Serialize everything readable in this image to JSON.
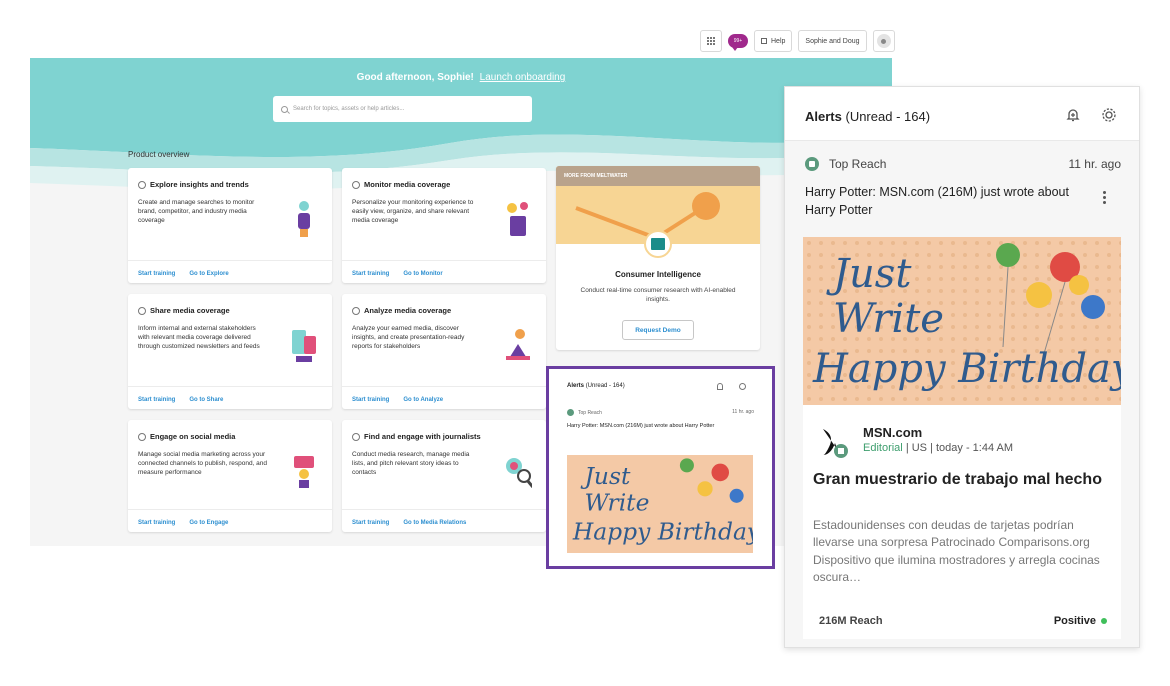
{
  "colors": {
    "teal": "#7fd3d1",
    "accent": "#a0298c",
    "highlight": "#6a3ea1",
    "link": "#2d8fd0",
    "positive": "#3fbf5b"
  },
  "topbar": {
    "apps_icon": "grid-icon",
    "chat_badge": "99+",
    "help_label": "Help",
    "user_label": "Sophie and Doug"
  },
  "hero": {
    "greeting": "Good afternoon, Sophie!",
    "onboarding_link": "Launch onboarding",
    "search_placeholder": "Search for topics, assets or help articles..."
  },
  "overview": {
    "label": "Product overview"
  },
  "cards": [
    {
      "title": "Explore insights and trends",
      "desc": "Create and manage searches to monitor brand, competitor, and industry media coverage",
      "link1": "Start training",
      "link2": "Go to Explore"
    },
    {
      "title": "Monitor media coverage",
      "desc": "Personalize your monitoring experience to easily view, organize, and share relevant media coverage",
      "link1": "Start training",
      "link2": "Go to Monitor"
    },
    {
      "title": "Share media coverage",
      "desc": "Inform internal and external stakeholders with relevant media coverage delivered through customized newsletters and feeds",
      "link1": "Start training",
      "link2": "Go to Share"
    },
    {
      "title": "Analyze media coverage",
      "desc": "Analyze your earned media, discover insights, and create presentation-ready reports for stakeholders",
      "link1": "Start training",
      "link2": "Go to Analyze"
    },
    {
      "title": "Engage on social media",
      "desc": "Manage social media marketing across your connected channels to publish, respond, and measure performance",
      "link1": "Start training",
      "link2": "Go to Engage"
    },
    {
      "title": "Find and engage with journalists",
      "desc": "Conduct media research, manage media lists, and pitch relevant story ideas to contacts",
      "link1": "Start training",
      "link2": "Go to Media Relations"
    }
  ],
  "promo": {
    "header": "MORE FROM MELTWATER",
    "title": "Consumer Intelligence",
    "desc": "Conduct real-time consumer research with AI-enabled insights.",
    "button": "Request Demo"
  },
  "alerts": {
    "title": "Alerts",
    "unread": "(Unread - 164)",
    "source": "Top Reach",
    "time": "11 hr. ago",
    "headline": "Harry Potter: MSN.com (216M) just wrote about Harry Potter",
    "image_text": [
      "Just",
      "Write",
      "Happy Birthday"
    ],
    "publisher": "MSN.com",
    "pub_type": "Editorial",
    "pub_meta": "| US | today - 1:44 AM",
    "article_title": "Gran muestrario de trabajo mal hecho",
    "snippet": "Estadounidenses con deudas de tarjetas podrían llevarse una sorpresa Patrocinado Comparisons.org Dispositivo que ilumina mostradores y arregla cocinas oscura…",
    "reach": "216M Reach",
    "sentiment": "Positive"
  }
}
